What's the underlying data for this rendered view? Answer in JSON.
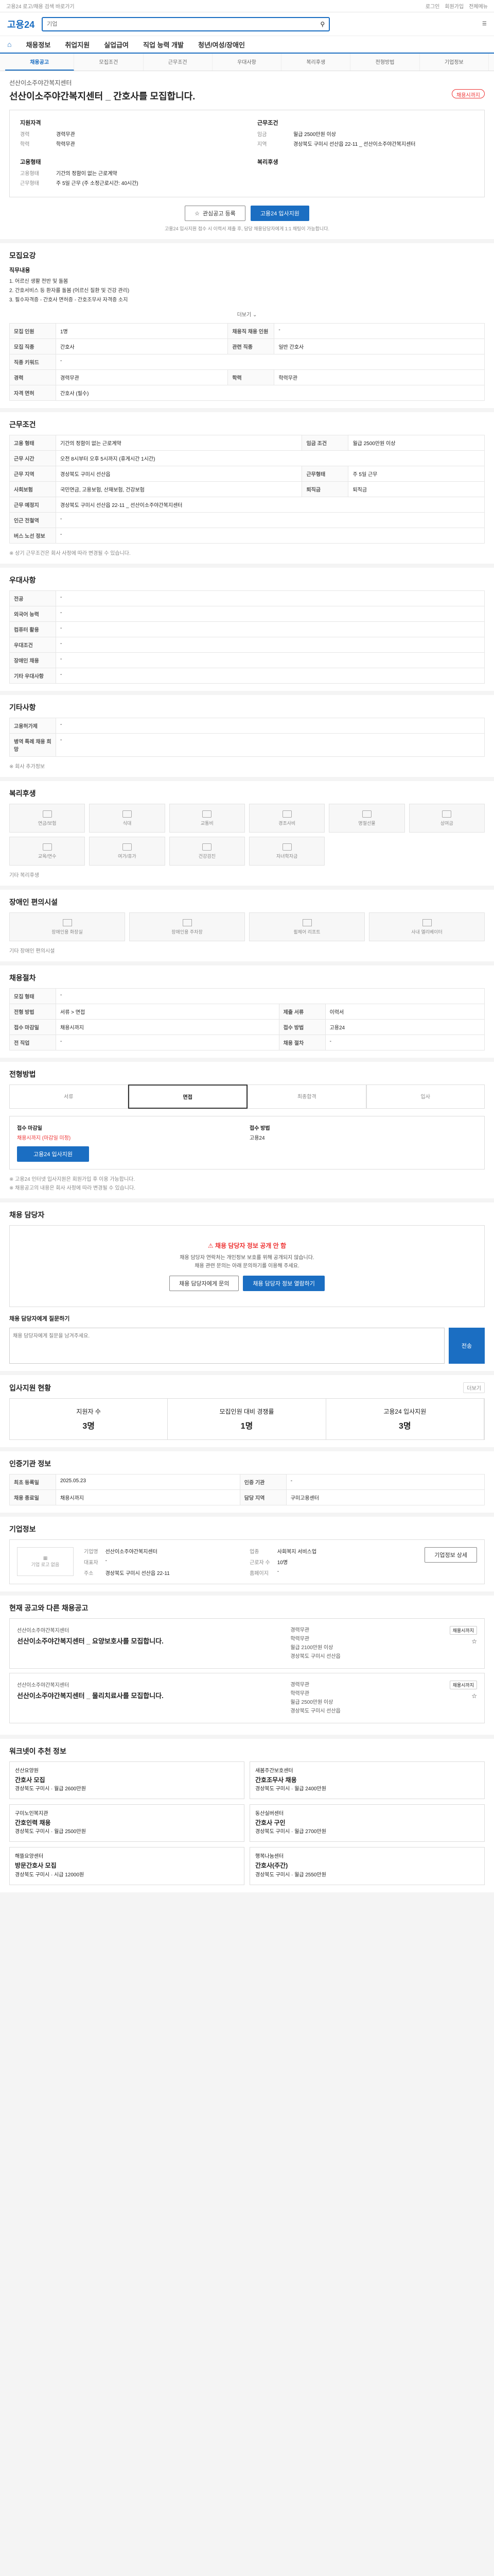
{
  "topbar": {
    "left": "고용24 로고/채용 검색 바로가기",
    "links": [
      "로그인",
      "회원가입",
      "전체메뉴"
    ]
  },
  "header": {
    "logo": "고용24",
    "search_placeholder": "기업"
  },
  "nav": {
    "items": [
      "채용정보",
      "취업지원",
      "실업급여",
      "직업 능력 개발",
      "청년/여성/장애인"
    ]
  },
  "tabs": [
    "채용공고",
    "모집조건",
    "근무조건",
    "우대사항",
    "복리후생",
    "전형방법",
    "기업정보"
  ],
  "job": {
    "company": "선산이소주야간복지센터",
    "title": "선산이소주야간복지센터 _ 간호사를 모집합니다.",
    "badge": "채용시까지"
  },
  "summary": {
    "left_title": "지원자격",
    "rows_left": [
      [
        "경력",
        "경력무관"
      ],
      [
        "학력",
        "학력무관"
      ]
    ],
    "right_title": "근무조건",
    "rows_right": [
      [
        "임금",
        "월급 2500만원 이상"
      ],
      [
        "지역",
        "경상북도 구미시 선산읍 22-11 _ 선산이소주야간복지센터"
      ]
    ],
    "left2_title": "고용형태",
    "rows_left2": [
      [
        "고용형태",
        "기간의 정함이 없는 근로계약"
      ],
      [
        "근무형태",
        "주 5일 근무 (주 소정근로시간: 40시간)"
      ]
    ],
    "right2_title": "복리후생",
    "rows_right2": []
  },
  "actions": {
    "scrap": "관심공고 등록",
    "apply": "고용24 입사지원"
  },
  "note": "고용24 입사지원 접수 시 이력서 제출 후, 담당 채용담당자에게 1:1 채팅이 가능합니다.",
  "recruit": {
    "title": "모집요강",
    "duties_title": "직무내용",
    "duties": [
      "1. 어르신 생활 전반 및 돌봄",
      "2. 간호서비스 등 환자를 돌봄 (어르신 질환 및 건강 관리)",
      "3. 필수자격증 - 간호사 면허증 - 간호조무사 자격증 소지"
    ],
    "more": "더보기",
    "rows": [
      [
        "모집 인원",
        "1명",
        "채용직 채용 인원",
        "-"
      ],
      [
        "모집 직종",
        "간호사",
        "관련 직종",
        "일반 간호사"
      ],
      [
        "직종 키워드",
        "-",
        "",
        ""
      ],
      [
        "경력",
        "경력무관",
        "학력",
        "학력무관"
      ],
      [
        "자격 면허",
        "간호사 (필수)",
        "",
        ""
      ]
    ]
  },
  "work": {
    "title": "근무조건",
    "rows": [
      [
        "고용 형태",
        "기간의 정함이 없는 근로계약",
        "임금 조건",
        "월급 2500만원 이상"
      ],
      [
        "",
        "-",
        "",
        ""
      ],
      [
        "근무 시간",
        "오전 8시부터 오후 5시까지 (휴게시간 1시간)",
        "",
        ""
      ],
      [
        "근무 지역",
        "경상북도 구미시 선산읍",
        "근무형태",
        "주 5일 근무"
      ],
      [
        "사회보험",
        "국민연금, 고용보험, 산재보험, 건강보험",
        "퇴직금",
        "퇴직금"
      ],
      [
        "근무 예정지",
        "경상북도 구미시 선산읍 22-11 _ 선산이소주야간복지센터",
        "",
        ""
      ],
      [
        "인근 전철역",
        "-",
        "",
        ""
      ],
      [
        "버스 노선 정보",
        "-",
        "",
        ""
      ]
    ],
    "note": "※ 상기 근무조건은 회사 사정에 따라 변경될 수 있습니다."
  },
  "pref": {
    "title": "우대사항",
    "rows": [
      [
        "전공",
        "-"
      ],
      [
        "외국어 능력",
        "-"
      ],
      [
        "컴퓨터 활용",
        "-"
      ],
      [
        "우대조건",
        "-"
      ],
      [
        "장애인 채용",
        "-"
      ],
      [
        "기타 우대사항",
        "-"
      ]
    ]
  },
  "other": {
    "title": "기타사항",
    "rows": [
      [
        "고용허가제",
        "-"
      ],
      [
        "병역 특례 채용 희망",
        "-"
      ]
    ],
    "extra": "※ 회사 추가정보"
  },
  "benefits": {
    "title": "복리후생",
    "items": [
      "연금/보험",
      "식대",
      "교통비",
      "경조사비",
      "명절선물",
      "상여금",
      "교육/연수",
      "여가/휴가",
      "건강검진",
      "자녀학자금"
    ],
    "etc_label": "기타 복리후생"
  },
  "facilities": {
    "title": "장애인 편의시설",
    "items": [
      "장애인용 화장실",
      "장애인용 주차장",
      "휠체어 리프트",
      "사내 엘리베이터"
    ],
    "etc_label": "기타 장애인 편의시설"
  },
  "transport": {
    "title": "채용절차",
    "rows": [
      [
        "모집 형태",
        "-",
        "",
        ""
      ],
      [
        "전형 방법",
        "서류 > 면접",
        "제출 서류",
        "이력서"
      ],
      [
        "접수 마감일",
        "채용시까지",
        "접수 방법",
        "고용24"
      ],
      [
        "전 직업",
        "-",
        "채용 절차",
        "-"
      ]
    ]
  },
  "process": {
    "title": "전형방법",
    "steps": [
      "서류",
      "면접",
      "최종합격",
      "입사"
    ],
    "apply_label": "접수 마감일",
    "apply_val": "채용시까지 (마감일 미정)",
    "method_label": "접수 방법",
    "method_val": "고용24",
    "btn": "고용24 입사지원",
    "notes": [
      "※ 고용24 인터넷 입사지원은 회원가입 후 이용 가능합니다.",
      "※ 채용공고의 내용은 회사 사정에 따라 변경될 수 있습니다."
    ]
  },
  "contact": {
    "title": "채용 담당자",
    "warn": "채용 담당자 정보 공개 안 함",
    "desc": [
      "채용 담당자 연락처는 개인정보 보호를 위해 공개되지 않습니다.",
      "채용 관련 문의는 아래 문의하기를 이용해 주세요."
    ],
    "btn1": "채용 담당자에게 문의",
    "btn2": "채용 담당자 정보 열람하기",
    "qa_title": "채용 담당자에게 질문하기",
    "qa_placeholder": "채용 담당자에게 질문을 남겨주세요.",
    "qa_send": "전송"
  },
  "stats": {
    "title": "입사지원 현황",
    "more": "더보기",
    "items": [
      [
        "지원자 수",
        "3명"
      ],
      [
        "모집인원 대비 경쟁률",
        "1명"
      ],
      [
        "고용24 입사지원",
        "3명"
      ]
    ]
  },
  "info": {
    "title": "인증기관 정보",
    "rows": [
      [
        "최초 등록일",
        "2025.05.23",
        "인증 기관",
        "-"
      ],
      [
        "채용 종료일",
        "채용시까지",
        "담당 지역",
        "구미고용센터"
      ]
    ]
  },
  "company": {
    "title": "기업정보",
    "logo": "기업 로고 없음",
    "more": "기업정보 상세",
    "rows": [
      [
        "기업명",
        "선산이소주야간복지센터",
        "업종",
        "사회복지 서비스업"
      ],
      [
        "대표자",
        "-",
        "근로자 수",
        "10명"
      ],
      [
        "주소",
        "경상북도 구미시 선산읍 22-11",
        "홈페이지",
        "-"
      ]
    ]
  },
  "related": {
    "title": "현재 공고와 다른 채용공고",
    "items": [
      {
        "co": "선산이소주야간복지센터",
        "t": "선산이소주야간복지센터 _ 요양보호사를 모집합니다.",
        "m": [
          "경력무관",
          "학력무관",
          "월급 2100만원 이상",
          "경상북도 구미시 선산읍"
        ],
        "tag": "채용시까지"
      },
      {
        "co": "선산이소주야간복지센터",
        "t": "선산이소주야간복지센터 _ 물리치료사를 모집합니다.",
        "m": [
          "경력무관",
          "학력무관",
          "월급 2500만원 이상",
          "경상북도 구미시 선산읍"
        ],
        "tag": "채용시까지"
      }
    ]
  },
  "recommend": {
    "title": "워크넷이 추천 정보",
    "items": [
      {
        "co": "선산요양원",
        "t": "간호사 모집",
        "m": "경상북도 구미시 · 월급 2600만원"
      },
      {
        "co": "새봄주간보호센터",
        "t": "간호조무사 채용",
        "m": "경상북도 구미시 · 월급 2400만원"
      },
      {
        "co": "구미노인복지관",
        "t": "간호인력 채용",
        "m": "경상북도 구미시 · 월급 2500만원"
      },
      {
        "co": "동산실버센터",
        "t": "간호사 구인",
        "m": "경상북도 구미시 · 월급 2700만원"
      },
      {
        "co": "해뜰요양센터",
        "t": "방문간호사 모집",
        "m": "경상북도 구미시 · 시급 12000원"
      },
      {
        "co": "행복나눔센터",
        "t": "간호사(주간)",
        "m": "경상북도 구미시 · 월급 2550만원"
      }
    ]
  }
}
